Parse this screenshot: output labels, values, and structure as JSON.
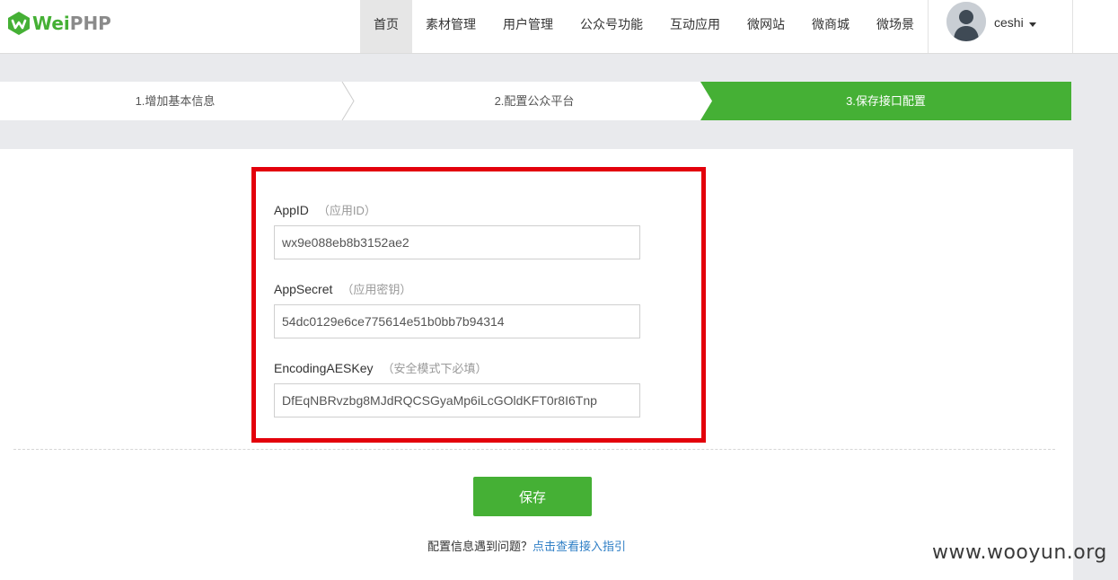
{
  "header": {
    "logo_text_primary": "Wei",
    "logo_text_secondary": "PHP",
    "nav": [
      {
        "label": "首页",
        "active": true
      },
      {
        "label": "素材管理"
      },
      {
        "label": "用户管理"
      },
      {
        "label": "公众号功能"
      },
      {
        "label": "互动应用"
      },
      {
        "label": "微网站"
      },
      {
        "label": "微商城"
      },
      {
        "label": "微场景"
      }
    ],
    "user": {
      "name": "ceshi"
    }
  },
  "steps": [
    {
      "label": "1.增加基本信息"
    },
    {
      "label": "2.配置公众平台"
    },
    {
      "label": "3.保存接口配置",
      "active": true
    }
  ],
  "form": {
    "fields": [
      {
        "label": "AppID",
        "hint": "（应用ID）",
        "value": "wx9e088eb8b3152ae2"
      },
      {
        "label": "AppSecret",
        "hint": "（应用密钥）",
        "value": "54dc0129e6ce775614e51b0bb7b94314"
      },
      {
        "label": "EncodingAESKey",
        "hint": "（安全模式下必填）",
        "value": "DfEqNBRvzbg8MJdRQCSGyaMp6iLcGOldKFT0r8I6Tnp"
      }
    ],
    "save_label": "保存",
    "help_text": "配置信息遇到问题？",
    "help_link": "点击查看接入指引"
  },
  "watermark": "www.wooyun.org",
  "colors": {
    "brand_green": "#45b035",
    "highlight_red": "#e3000b",
    "link_blue": "#2f7fc6"
  }
}
